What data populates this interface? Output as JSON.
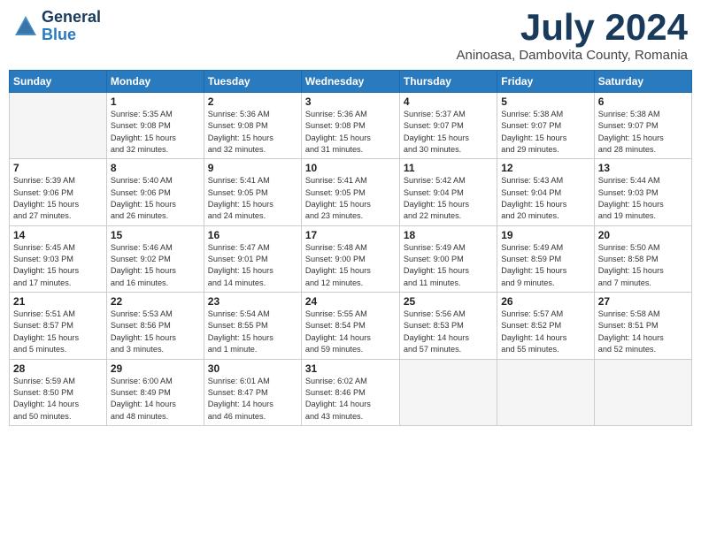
{
  "logo": {
    "general": "General",
    "blue": "Blue"
  },
  "title": "July 2024",
  "location": "Aninoasa, Dambovita County, Romania",
  "weekdays": [
    "Sunday",
    "Monday",
    "Tuesday",
    "Wednesday",
    "Thursday",
    "Friday",
    "Saturday"
  ],
  "weeks": [
    [
      {
        "day": "",
        "info": ""
      },
      {
        "day": "1",
        "info": "Sunrise: 5:35 AM\nSunset: 9:08 PM\nDaylight: 15 hours\nand 32 minutes."
      },
      {
        "day": "2",
        "info": "Sunrise: 5:36 AM\nSunset: 9:08 PM\nDaylight: 15 hours\nand 32 minutes."
      },
      {
        "day": "3",
        "info": "Sunrise: 5:36 AM\nSunset: 9:08 PM\nDaylight: 15 hours\nand 31 minutes."
      },
      {
        "day": "4",
        "info": "Sunrise: 5:37 AM\nSunset: 9:07 PM\nDaylight: 15 hours\nand 30 minutes."
      },
      {
        "day": "5",
        "info": "Sunrise: 5:38 AM\nSunset: 9:07 PM\nDaylight: 15 hours\nand 29 minutes."
      },
      {
        "day": "6",
        "info": "Sunrise: 5:38 AM\nSunset: 9:07 PM\nDaylight: 15 hours\nand 28 minutes."
      }
    ],
    [
      {
        "day": "7",
        "info": "Sunrise: 5:39 AM\nSunset: 9:06 PM\nDaylight: 15 hours\nand 27 minutes."
      },
      {
        "day": "8",
        "info": "Sunrise: 5:40 AM\nSunset: 9:06 PM\nDaylight: 15 hours\nand 26 minutes."
      },
      {
        "day": "9",
        "info": "Sunrise: 5:41 AM\nSunset: 9:05 PM\nDaylight: 15 hours\nand 24 minutes."
      },
      {
        "day": "10",
        "info": "Sunrise: 5:41 AM\nSunset: 9:05 PM\nDaylight: 15 hours\nand 23 minutes."
      },
      {
        "day": "11",
        "info": "Sunrise: 5:42 AM\nSunset: 9:04 PM\nDaylight: 15 hours\nand 22 minutes."
      },
      {
        "day": "12",
        "info": "Sunrise: 5:43 AM\nSunset: 9:04 PM\nDaylight: 15 hours\nand 20 minutes."
      },
      {
        "day": "13",
        "info": "Sunrise: 5:44 AM\nSunset: 9:03 PM\nDaylight: 15 hours\nand 19 minutes."
      }
    ],
    [
      {
        "day": "14",
        "info": "Sunrise: 5:45 AM\nSunset: 9:03 PM\nDaylight: 15 hours\nand 17 minutes."
      },
      {
        "day": "15",
        "info": "Sunrise: 5:46 AM\nSunset: 9:02 PM\nDaylight: 15 hours\nand 16 minutes."
      },
      {
        "day": "16",
        "info": "Sunrise: 5:47 AM\nSunset: 9:01 PM\nDaylight: 15 hours\nand 14 minutes."
      },
      {
        "day": "17",
        "info": "Sunrise: 5:48 AM\nSunset: 9:00 PM\nDaylight: 15 hours\nand 12 minutes."
      },
      {
        "day": "18",
        "info": "Sunrise: 5:49 AM\nSunset: 9:00 PM\nDaylight: 15 hours\nand 11 minutes."
      },
      {
        "day": "19",
        "info": "Sunrise: 5:49 AM\nSunset: 8:59 PM\nDaylight: 15 hours\nand 9 minutes."
      },
      {
        "day": "20",
        "info": "Sunrise: 5:50 AM\nSunset: 8:58 PM\nDaylight: 15 hours\nand 7 minutes."
      }
    ],
    [
      {
        "day": "21",
        "info": "Sunrise: 5:51 AM\nSunset: 8:57 PM\nDaylight: 15 hours\nand 5 minutes."
      },
      {
        "day": "22",
        "info": "Sunrise: 5:53 AM\nSunset: 8:56 PM\nDaylight: 15 hours\nand 3 minutes."
      },
      {
        "day": "23",
        "info": "Sunrise: 5:54 AM\nSunset: 8:55 PM\nDaylight: 15 hours\nand 1 minute."
      },
      {
        "day": "24",
        "info": "Sunrise: 5:55 AM\nSunset: 8:54 PM\nDaylight: 14 hours\nand 59 minutes."
      },
      {
        "day": "25",
        "info": "Sunrise: 5:56 AM\nSunset: 8:53 PM\nDaylight: 14 hours\nand 57 minutes."
      },
      {
        "day": "26",
        "info": "Sunrise: 5:57 AM\nSunset: 8:52 PM\nDaylight: 14 hours\nand 55 minutes."
      },
      {
        "day": "27",
        "info": "Sunrise: 5:58 AM\nSunset: 8:51 PM\nDaylight: 14 hours\nand 52 minutes."
      }
    ],
    [
      {
        "day": "28",
        "info": "Sunrise: 5:59 AM\nSunset: 8:50 PM\nDaylight: 14 hours\nand 50 minutes."
      },
      {
        "day": "29",
        "info": "Sunrise: 6:00 AM\nSunset: 8:49 PM\nDaylight: 14 hours\nand 48 minutes."
      },
      {
        "day": "30",
        "info": "Sunrise: 6:01 AM\nSunset: 8:47 PM\nDaylight: 14 hours\nand 46 minutes."
      },
      {
        "day": "31",
        "info": "Sunrise: 6:02 AM\nSunset: 8:46 PM\nDaylight: 14 hours\nand 43 minutes."
      },
      {
        "day": "",
        "info": ""
      },
      {
        "day": "",
        "info": ""
      },
      {
        "day": "",
        "info": ""
      }
    ]
  ]
}
